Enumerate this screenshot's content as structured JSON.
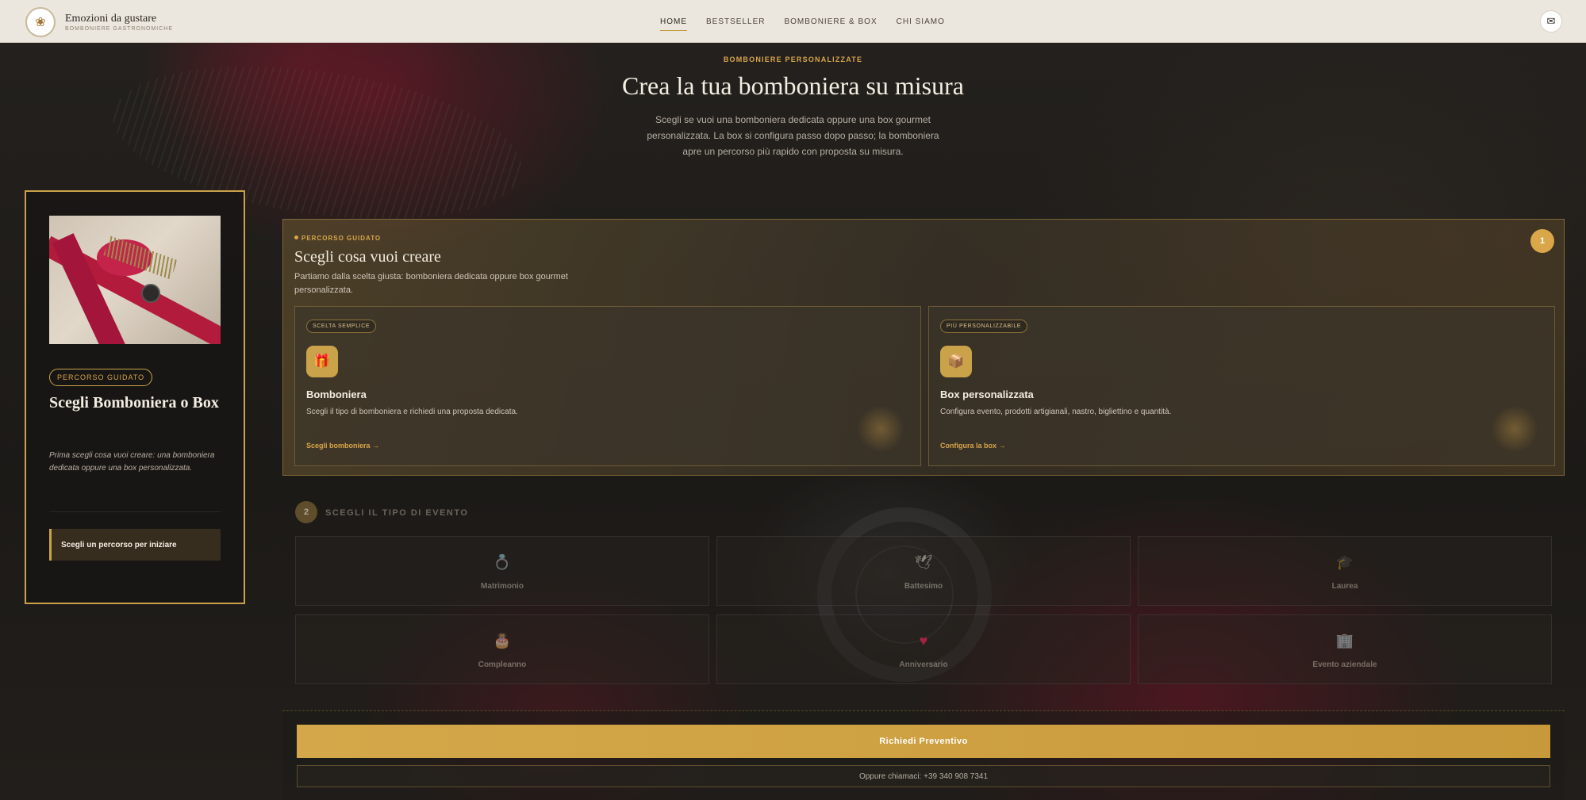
{
  "header": {
    "brand_title": "Emozioni da gustare",
    "brand_subtitle": "BOMBONIERE GASTRONOMICHE",
    "nav": [
      "HOME",
      "BESTSELLER",
      "BOMBONIERE & BOX",
      "CHI SIAMO"
    ],
    "active_nav": "HOME"
  },
  "hero": {
    "eyebrow": "BOMBONIERE PERSONALIZZATE",
    "title": "Crea la tua bomboniera su misura",
    "description": "Scegli se vuoi una bomboniera dedicata oppure una box gourmet personalizzata. La box si configura passo dopo passo; la bomboniera apre un percorso più rapido con proposta su misura."
  },
  "sidebar": {
    "badge": "PERCORSO GUIDATO",
    "title": "Scegli Bomboniera o Box",
    "description": "Prima scegli cosa vuoi creare: una bomboniera dedicata oppure una box personalizzata.",
    "cta": "Scegli un percorso per iniziare"
  },
  "step1": {
    "number": "1",
    "eyebrow": "PERCORSO GUIDATO",
    "title": "Scegli cosa vuoi creare",
    "description": "Partiamo dalla scelta giusta: bomboniera dedicata oppure box gourmet personalizzata.",
    "options": [
      {
        "badge": "SCELTA SEMPLICE",
        "icon": "gift-bag-icon",
        "title": "Bomboniera",
        "description": "Scegli il tipo di bomboniera e richiedi una proposta dedicata.",
        "link": "Scegli bomboniera →"
      },
      {
        "badge": "PIÙ PERSONALIZZABILE",
        "icon": "gift-box-icon",
        "title": "Box personalizzata",
        "description": "Configura evento, prodotti artigianali, nastro, bigliettino e quantità.",
        "link": "Configura la box →"
      }
    ]
  },
  "step2": {
    "number": "2",
    "label": "SCEGLI IL TIPO DI EVENTO",
    "events": [
      {
        "label": "Matrimonio",
        "icon": "ring-icon"
      },
      {
        "label": "Battesimo",
        "icon": "dove-icon"
      },
      {
        "label": "Laurea",
        "icon": "graduation-icon"
      },
      {
        "label": "Compleanno",
        "icon": "cake-icon"
      },
      {
        "label": "Anniversario",
        "icon": "heart-icon"
      },
      {
        "label": "Evento aziendale",
        "icon": "office-icon"
      }
    ]
  },
  "footer": {
    "quote_button": "Richiedi Preventivo",
    "call_text": "Oppure chiamaci: +39 340 908 7341"
  },
  "colors": {
    "accent": "#d9a64a",
    "header_bg": "#ebe6de",
    "page_bg": "#1e1b18"
  }
}
